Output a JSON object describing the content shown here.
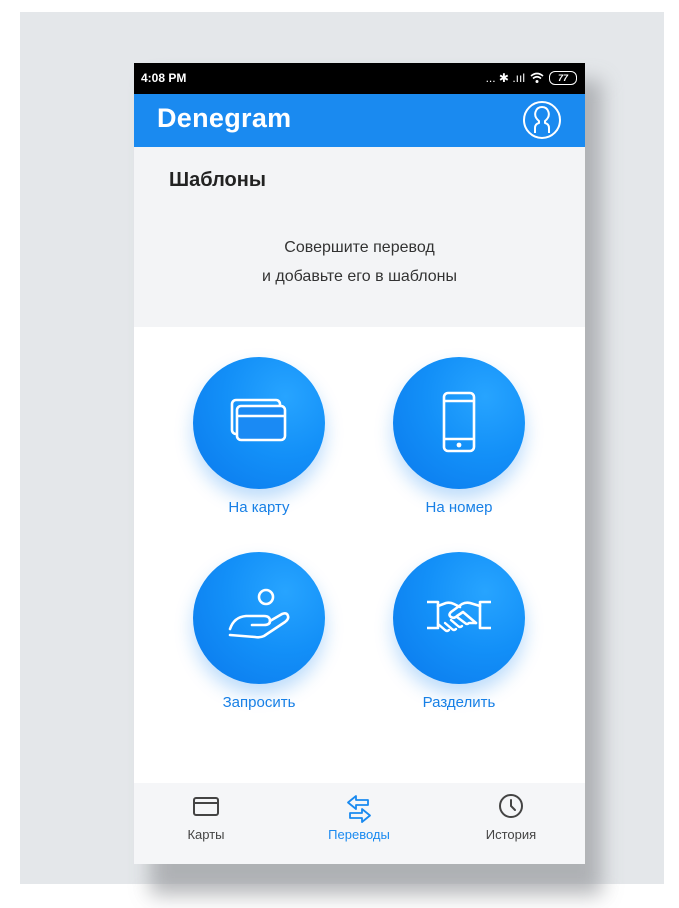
{
  "status_bar": {
    "time": "4:08 PM",
    "indicators": "... ✱ .ııl",
    "battery": "77"
  },
  "app_bar": {
    "logo": "Denegram",
    "profile_icon": "user-circle-icon"
  },
  "templates": {
    "title": "Шаблоны",
    "hint_line1": "Совершите перевод",
    "hint_line2": "и добавьте его в шаблоны"
  },
  "actions": [
    {
      "label": "На карту",
      "icon": "cards-icon"
    },
    {
      "label": "На номер",
      "icon": "smartphone-icon"
    },
    {
      "label": "Запросить",
      "icon": "hand-coin-icon"
    },
    {
      "label": "Разделить",
      "icon": "handshake-icon"
    }
  ],
  "bottom_nav": {
    "items": [
      {
        "label": "Карты",
        "icon": "card-icon",
        "active": false
      },
      {
        "label": "Переводы",
        "icon": "transfer-arrows-icon",
        "active": true
      },
      {
        "label": "История",
        "icon": "clock-icon",
        "active": false
      }
    ]
  },
  "colors": {
    "brand": "#1a8af0",
    "action_label": "#1880e6",
    "nav_active": "#1a8af0",
    "nav_inactive": "#444444"
  }
}
